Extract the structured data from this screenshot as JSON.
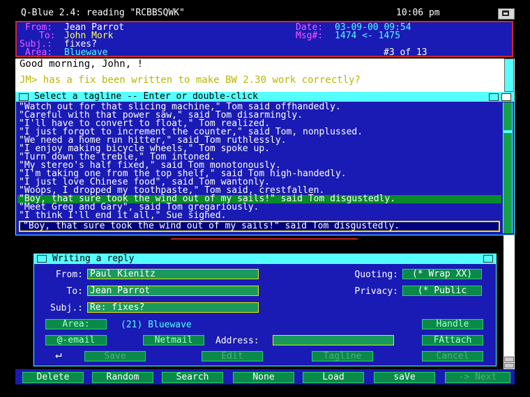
{
  "app": {
    "title": "Q-Blue 2.4:  reading \"RCBBSQWK\"",
    "clock": "10:06 pm"
  },
  "header": {
    "from_label": "From:",
    "from_value": "Jean Parrot",
    "to_label": "To:",
    "to_value": "John Mork",
    "subj_label": "Subj.:",
    "subj_value": "fixes?",
    "area_label": "Area:",
    "area_value": "Bluewave",
    "date_label": "Date:",
    "date_value": "03-09-00 09:54",
    "msg_label": "Msg#:",
    "msg_value": "1474 <- 1475",
    "position": "#3 of 13"
  },
  "message": {
    "line1": "Good morning, John, !",
    "line2": "JM> has a fix been written to make BW 2.30 work correctly?"
  },
  "tagline_window": {
    "title": "Select a tagline -- Enter or double-click",
    "items": [
      "\"Watch out for that slicing machine,\" Tom said offhandedly.",
      "\"Careful with that power saw,\" said Tom disarmingly.",
      "\"I'll have to convert to float,\" Tom realized.",
      "\"I just forgot to increment the counter,\" said Tom, nonplussed.",
      "\"We need a home run hitter,\" said Tom ruthlessly.",
      "\"I enjoy making bicycle wheels,\" Tom spoke up.",
      "\"Turn down the treble,\" Tom intoned.",
      "\"My stereo's half fixed,\" said Tom monotonously.",
      "\"I'm taking one from the top shelf,\" said Tom high-handedly.",
      "\"I just love Chinese food\", said Tom wantonly.",
      "\"Woops, I dropped my toothpaste,\" Tom said, crestfallen.",
      "\"Boy, that sure took the wind out of my sails!\" said Tom disgustedly.",
      "\"Meet Greg and Gary\", said Tom gregariously.",
      "\"I think I'll end it all,\" Sue sighed."
    ],
    "selected_index": 11,
    "edit_value": "\"Boy, that sure took the wind out of my sails!\" said Tom disgustedly."
  },
  "reply_window": {
    "title": "Writing a reply",
    "from_label": "From:",
    "from_value": "Paul Kienitz",
    "to_label": "To:",
    "to_value": "Jean Parrot",
    "subj_label": "Subj.:",
    "subj_value": "Re: fixes?",
    "quoting_label": "Quoting:",
    "quoting_value": "(*  Wrap XX)",
    "privacy_label": "Privacy:",
    "privacy_value": "(*   Public",
    "area_button": "Area:",
    "area_value": "(21) Bluewave",
    "handle_button": "Handle",
    "email_button": "@-email",
    "netmail_button": "Netmail",
    "address_label": "Address:",
    "address_value": "",
    "fattach_button": "FAttach",
    "enter_glyph": "↵",
    "save_button": "Save",
    "edit_button": "Edit",
    "tagline_button": "Tagline",
    "cancel_button": "Cancel"
  },
  "bottom_bar": {
    "delete": "Delete",
    "random": "Random",
    "search": "Search",
    "none": "None",
    "load": "Load",
    "save": "saVe",
    "next": "-> Next"
  },
  "colors": {
    "panel_blue": "#1a1ab4",
    "title_cyan": "#55ffff",
    "button_green": "#0a8a4a",
    "highlight_yellow": "#ffff55",
    "label_magenta": "#ff55ff",
    "border_red": "#d02828"
  }
}
